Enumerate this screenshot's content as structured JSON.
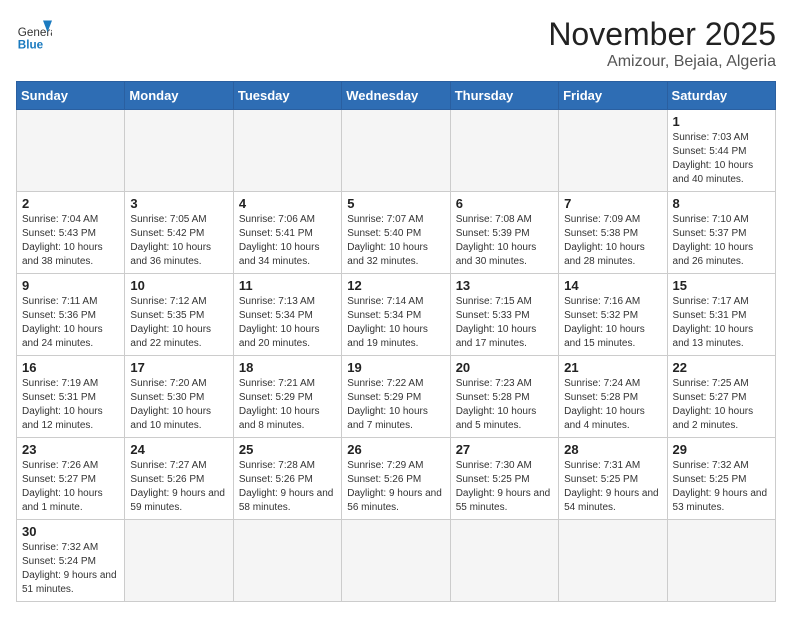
{
  "logo": {
    "general": "General",
    "blue": "Blue"
  },
  "header": {
    "month": "November 2025",
    "location": "Amizour, Bejaia, Algeria"
  },
  "weekdays": [
    "Sunday",
    "Monday",
    "Tuesday",
    "Wednesday",
    "Thursday",
    "Friday",
    "Saturday"
  ],
  "weeks": [
    [
      {
        "day": "",
        "info": ""
      },
      {
        "day": "",
        "info": ""
      },
      {
        "day": "",
        "info": ""
      },
      {
        "day": "",
        "info": ""
      },
      {
        "day": "",
        "info": ""
      },
      {
        "day": "",
        "info": ""
      },
      {
        "day": "1",
        "info": "Sunrise: 7:03 AM\nSunset: 5:44 PM\nDaylight: 10 hours and 40 minutes."
      }
    ],
    [
      {
        "day": "2",
        "info": "Sunrise: 7:04 AM\nSunset: 5:43 PM\nDaylight: 10 hours and 38 minutes."
      },
      {
        "day": "3",
        "info": "Sunrise: 7:05 AM\nSunset: 5:42 PM\nDaylight: 10 hours and 36 minutes."
      },
      {
        "day": "4",
        "info": "Sunrise: 7:06 AM\nSunset: 5:41 PM\nDaylight: 10 hours and 34 minutes."
      },
      {
        "day": "5",
        "info": "Sunrise: 7:07 AM\nSunset: 5:40 PM\nDaylight: 10 hours and 32 minutes."
      },
      {
        "day": "6",
        "info": "Sunrise: 7:08 AM\nSunset: 5:39 PM\nDaylight: 10 hours and 30 minutes."
      },
      {
        "day": "7",
        "info": "Sunrise: 7:09 AM\nSunset: 5:38 PM\nDaylight: 10 hours and 28 minutes."
      },
      {
        "day": "8",
        "info": "Sunrise: 7:10 AM\nSunset: 5:37 PM\nDaylight: 10 hours and 26 minutes."
      }
    ],
    [
      {
        "day": "9",
        "info": "Sunrise: 7:11 AM\nSunset: 5:36 PM\nDaylight: 10 hours and 24 minutes."
      },
      {
        "day": "10",
        "info": "Sunrise: 7:12 AM\nSunset: 5:35 PM\nDaylight: 10 hours and 22 minutes."
      },
      {
        "day": "11",
        "info": "Sunrise: 7:13 AM\nSunset: 5:34 PM\nDaylight: 10 hours and 20 minutes."
      },
      {
        "day": "12",
        "info": "Sunrise: 7:14 AM\nSunset: 5:34 PM\nDaylight: 10 hours and 19 minutes."
      },
      {
        "day": "13",
        "info": "Sunrise: 7:15 AM\nSunset: 5:33 PM\nDaylight: 10 hours and 17 minutes."
      },
      {
        "day": "14",
        "info": "Sunrise: 7:16 AM\nSunset: 5:32 PM\nDaylight: 10 hours and 15 minutes."
      },
      {
        "day": "15",
        "info": "Sunrise: 7:17 AM\nSunset: 5:31 PM\nDaylight: 10 hours and 13 minutes."
      }
    ],
    [
      {
        "day": "16",
        "info": "Sunrise: 7:19 AM\nSunset: 5:31 PM\nDaylight: 10 hours and 12 minutes."
      },
      {
        "day": "17",
        "info": "Sunrise: 7:20 AM\nSunset: 5:30 PM\nDaylight: 10 hours and 10 minutes."
      },
      {
        "day": "18",
        "info": "Sunrise: 7:21 AM\nSunset: 5:29 PM\nDaylight: 10 hours and 8 minutes."
      },
      {
        "day": "19",
        "info": "Sunrise: 7:22 AM\nSunset: 5:29 PM\nDaylight: 10 hours and 7 minutes."
      },
      {
        "day": "20",
        "info": "Sunrise: 7:23 AM\nSunset: 5:28 PM\nDaylight: 10 hours and 5 minutes."
      },
      {
        "day": "21",
        "info": "Sunrise: 7:24 AM\nSunset: 5:28 PM\nDaylight: 10 hours and 4 minutes."
      },
      {
        "day": "22",
        "info": "Sunrise: 7:25 AM\nSunset: 5:27 PM\nDaylight: 10 hours and 2 minutes."
      }
    ],
    [
      {
        "day": "23",
        "info": "Sunrise: 7:26 AM\nSunset: 5:27 PM\nDaylight: 10 hours and 1 minute."
      },
      {
        "day": "24",
        "info": "Sunrise: 7:27 AM\nSunset: 5:26 PM\nDaylight: 9 hours and 59 minutes."
      },
      {
        "day": "25",
        "info": "Sunrise: 7:28 AM\nSunset: 5:26 PM\nDaylight: 9 hours and 58 minutes."
      },
      {
        "day": "26",
        "info": "Sunrise: 7:29 AM\nSunset: 5:26 PM\nDaylight: 9 hours and 56 minutes."
      },
      {
        "day": "27",
        "info": "Sunrise: 7:30 AM\nSunset: 5:25 PM\nDaylight: 9 hours and 55 minutes."
      },
      {
        "day": "28",
        "info": "Sunrise: 7:31 AM\nSunset: 5:25 PM\nDaylight: 9 hours and 54 minutes."
      },
      {
        "day": "29",
        "info": "Sunrise: 7:32 AM\nSunset: 5:25 PM\nDaylight: 9 hours and 53 minutes."
      }
    ],
    [
      {
        "day": "30",
        "info": "Sunrise: 7:32 AM\nSunset: 5:24 PM\nDaylight: 9 hours and 51 minutes."
      },
      {
        "day": "",
        "info": ""
      },
      {
        "day": "",
        "info": ""
      },
      {
        "day": "",
        "info": ""
      },
      {
        "day": "",
        "info": ""
      },
      {
        "day": "",
        "info": ""
      },
      {
        "day": "",
        "info": ""
      }
    ]
  ]
}
